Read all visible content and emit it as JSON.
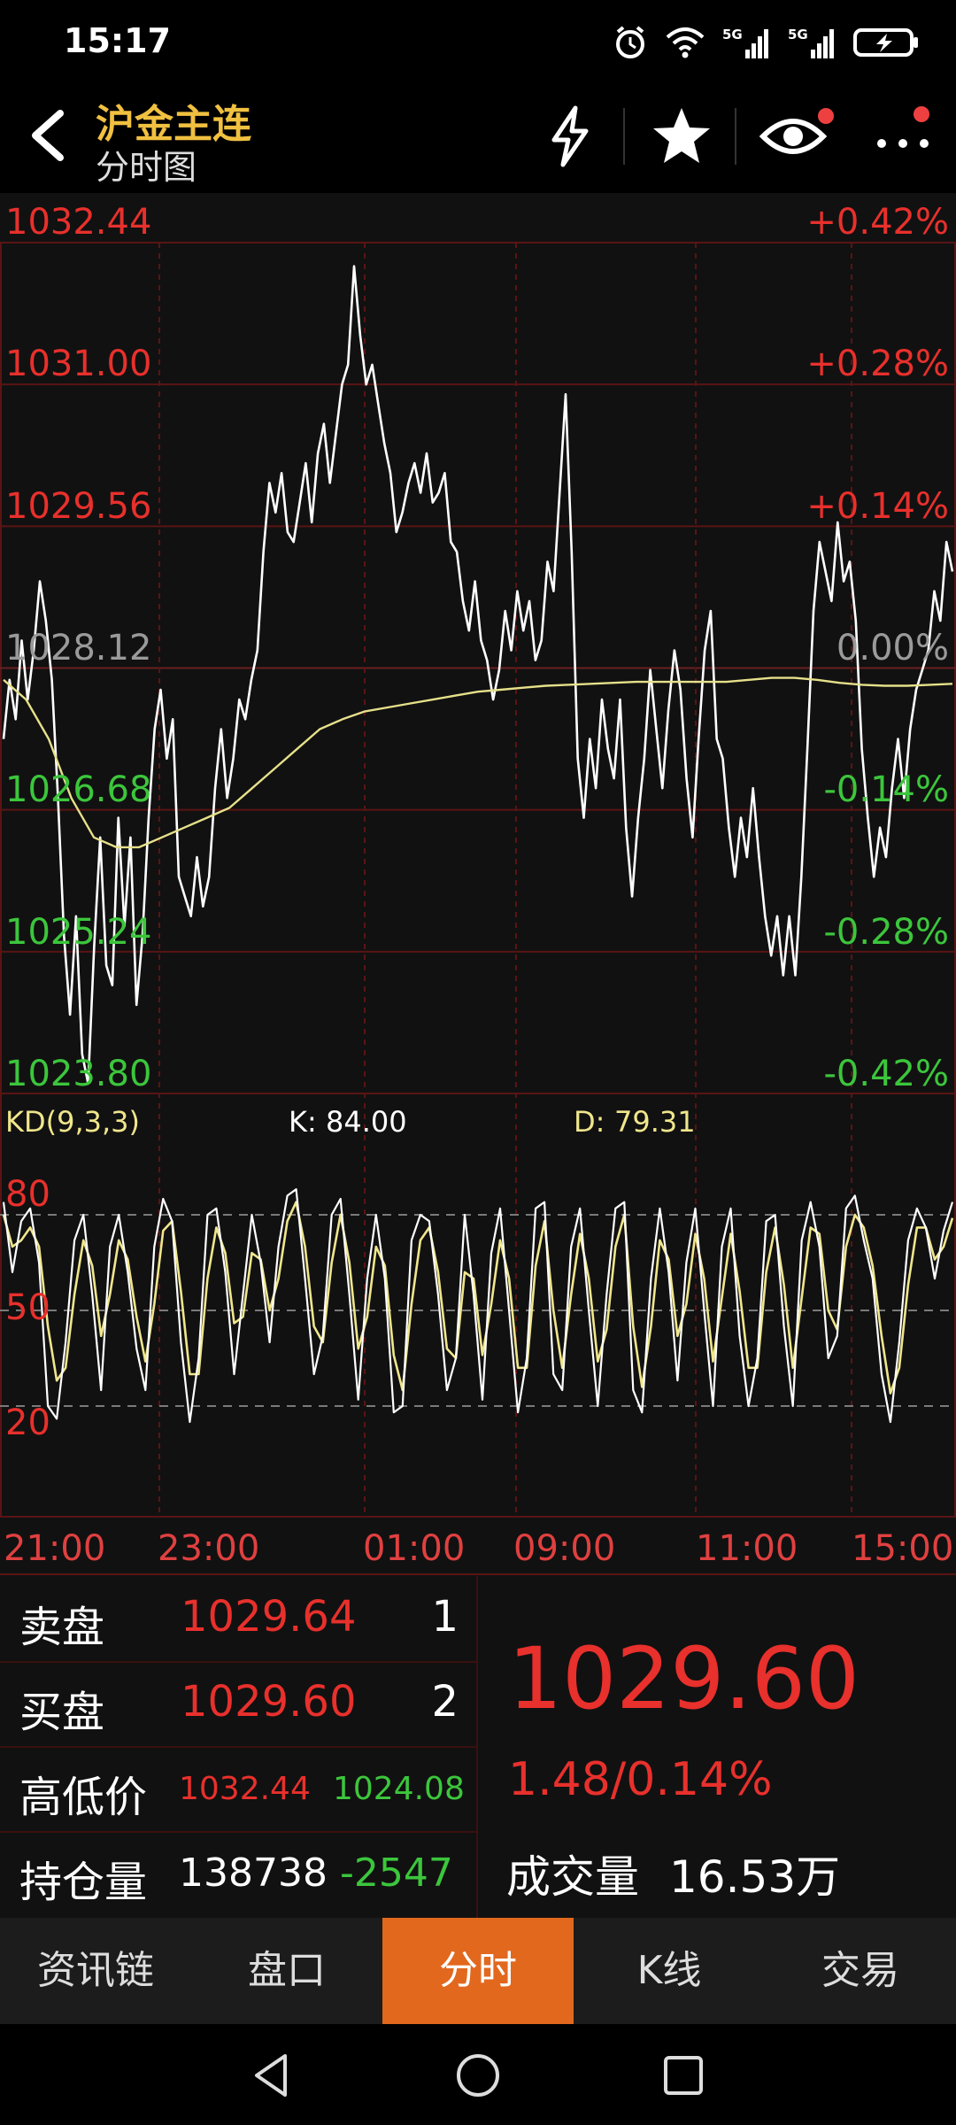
{
  "status_bar": {
    "time": "15:17",
    "icons": [
      "alarm-icon",
      "wifi-icon",
      "5g-signal-icon",
      "5g-signal-icon",
      "battery-charging-icon"
    ]
  },
  "header": {
    "title": "沪金主连",
    "subtitle": "分时图",
    "buttons": [
      "lightning-icon",
      "star-icon",
      "eye-icon",
      "more-icon"
    ]
  },
  "chart_data": [
    {
      "type": "line",
      "title": "",
      "xlabel": "",
      "ylabel": "",
      "x_ticks": [
        "21:00",
        "23:00",
        "01:00",
        "09:00",
        "11:00",
        "15:00"
      ],
      "y_ticks_left": [
        "1032.44",
        "1031.00",
        "1029.56",
        "1028.12",
        "1026.68",
        "1025.24",
        "1023.80"
      ],
      "y_ticks_right": [
        "+0.42%",
        "+0.28%",
        "+0.14%",
        "0.00%",
        "-0.14%",
        "-0.28%",
        "-0.42%"
      ],
      "ylim": [
        1023.8,
        1032.44
      ],
      "reference_price": 1028.12,
      "colors": {
        "up": "#e8302c",
        "flat": "#9a9a9a",
        "down": "#3cc63c",
        "price_line": "#ffffff",
        "avg_line": "#e6e08a",
        "grid": "#5a1414"
      },
      "series": [
        {
          "values": [
            1027.4,
            1028.0,
            1027.6,
            1028.4,
            1027.8,
            1028.3,
            1029.0,
            1028.6,
            1028.0,
            1026.8,
            1025.4,
            1024.6,
            1025.6,
            1024.2,
            1023.9,
            1025.3,
            1026.4,
            1025.1,
            1024.9,
            1026.6,
            1025.5,
            1026.4,
            1024.7,
            1025.4,
            1026.6,
            1027.5,
            1027.9,
            1027.2,
            1027.6,
            1026.0,
            1025.8,
            1025.6,
            1026.2,
            1025.7,
            1026.0,
            1026.9,
            1027.5,
            1026.8,
            1027.2,
            1027.8,
            1027.6,
            1028.0,
            1028.3,
            1029.3,
            1030.0,
            1029.7,
            1030.1,
            1029.5,
            1029.4,
            1029.8,
            1030.2,
            1029.6,
            1030.3,
            1030.6,
            1030.0,
            1030.5,
            1031.0,
            1031.2,
            1032.2,
            1031.5,
            1031.0,
            1031.2,
            1030.8,
            1030.4,
            1030.1,
            1029.5,
            1029.7,
            1030.0,
            1030.2,
            1029.9,
            1030.3,
            1029.8,
            1029.9,
            1030.1,
            1029.4,
            1029.3,
            1028.8,
            1028.5,
            1029.0,
            1028.4,
            1028.2,
            1027.8,
            1028.1,
            1028.7,
            1028.3,
            1028.9,
            1028.5,
            1028.8,
            1028.2,
            1028.4,
            1029.2,
            1028.9,
            1029.9,
            1030.9,
            1029.3,
            1027.2,
            1026.6,
            1027.4,
            1026.9,
            1027.8,
            1027.3,
            1027.0,
            1027.8,
            1026.5,
            1025.8,
            1026.6,
            1027.2,
            1028.1,
            1027.5,
            1026.9,
            1027.7,
            1028.3,
            1027.9,
            1027.0,
            1026.4,
            1027.4,
            1028.3,
            1028.7,
            1027.4,
            1027.2,
            1026.5,
            1026.0,
            1026.6,
            1026.2,
            1026.9,
            1026.2,
            1025.6,
            1025.2,
            1025.6,
            1025.0,
            1025.6,
            1025.0,
            1026.0,
            1027.3,
            1028.7,
            1029.4,
            1029.1,
            1028.8,
            1029.6,
            1029.0,
            1029.2,
            1028.6,
            1027.3,
            1026.6,
            1026.0,
            1026.5,
            1026.2,
            1026.9,
            1027.4,
            1026.8,
            1027.5,
            1027.9,
            1028.1,
            1028.3,
            1028.9,
            1028.6,
            1029.4,
            1029.1
          ]
        },
        {
          "values": [
            1028.0,
            1027.8,
            1027.4,
            1026.8,
            1026.4,
            1026.3,
            1026.3,
            1026.4,
            1026.5,
            1026.6,
            1026.7,
            1026.9,
            1027.1,
            1027.3,
            1027.5,
            1027.6,
            1027.68,
            1027.72,
            1027.76,
            1027.8,
            1027.84,
            1027.88,
            1027.9,
            1027.92,
            1027.94,
            1027.95,
            1027.96,
            1027.97,
            1027.98,
            1027.98,
            1027.98,
            1027.98,
            1027.98,
            1028.0,
            1028.02,
            1028.02,
            1028.0,
            1027.97,
            1027.95,
            1027.94,
            1027.94,
            1027.95,
            1027.96
          ]
        }
      ]
    },
    {
      "type": "line",
      "title": "KD(9,3,3)",
      "x_ticks": [
        "21:00",
        "23:00",
        "01:00",
        "09:00",
        "11:00",
        "15:00"
      ],
      "y_ticks": [
        "80",
        "50",
        "20"
      ],
      "ylim": [
        0,
        100
      ],
      "readouts": [
        {
          "label": "K:",
          "value": "84.00"
        },
        {
          "label": "D:",
          "value": "79.31"
        }
      ],
      "colors": {
        "k": "#ffffff",
        "d": "#f0e68c",
        "label_k": "#ffffff",
        "label_d": "#f0e68c"
      },
      "series": [
        {
          "name": "K",
          "values": [
            84,
            62,
            78,
            82,
            65,
            20,
            16,
            40,
            72,
            80,
            55,
            25,
            70,
            80,
            62,
            38,
            25,
            70,
            85,
            78,
            40,
            15,
            35,
            80,
            82,
            62,
            30,
            55,
            80,
            65,
            40,
            70,
            86,
            88,
            60,
            30,
            42,
            80,
            85,
            55,
            22,
            60,
            80,
            60,
            18,
            20,
            72,
            80,
            78,
            55,
            25,
            35,
            80,
            55,
            22,
            68,
            82,
            50,
            18,
            35,
            82,
            84,
            30,
            25,
            70,
            82,
            50,
            20,
            55,
            82,
            84,
            25,
            18,
            60,
            82,
            62,
            28,
            65,
            82,
            50,
            20,
            70,
            82,
            42,
            20,
            35,
            78,
            80,
            45,
            20,
            72,
            84,
            70,
            35,
            42,
            82,
            86,
            72,
            60,
            30,
            15,
            40,
            72,
            82,
            76,
            60,
            75,
            84
          ]
        },
        {
          "name": "D",
          "values": [
            80,
            70,
            72,
            76,
            70,
            45,
            28,
            32,
            55,
            72,
            64,
            42,
            55,
            72,
            66,
            48,
            34,
            52,
            75,
            78,
            56,
            30,
            30,
            60,
            76,
            68,
            46,
            48,
            68,
            66,
            50,
            60,
            78,
            84,
            70,
            45,
            40,
            65,
            80,
            65,
            38,
            48,
            70,
            64,
            36,
            25,
            52,
            72,
            76,
            62,
            38,
            35,
            62,
            60,
            36,
            52,
            72,
            60,
            32,
            32,
            64,
            78,
            50,
            32,
            55,
            74,
            60,
            34,
            44,
            70,
            80,
            45,
            26,
            45,
            72,
            66,
            42,
            52,
            74,
            60,
            34,
            54,
            74,
            56,
            32,
            32,
            62,
            76,
            58,
            32,
            54,
            76,
            74,
            50,
            44,
            70,
            80,
            76,
            64,
            42,
            24,
            32,
            58,
            76,
            76,
            66,
            70,
            79
          ]
        }
      ]
    }
  ],
  "quote": {
    "sell_label": "卖盘",
    "sell_price": "1029.64",
    "sell_qty": "1",
    "buy_label": "买盘",
    "buy_price": "1029.60",
    "buy_qty": "2",
    "hl_label": "高低价",
    "high": "1032.44",
    "low": "1024.08",
    "oi_label": "持仓量",
    "oi": "138738",
    "oi_change": "-2547",
    "last_price": "1029.60",
    "change": "1.48/0.14%",
    "volume_label": "成交量",
    "volume": "16.53万"
  },
  "tabs": [
    {
      "label": "资讯链",
      "active": false
    },
    {
      "label": "盘口",
      "active": false
    },
    {
      "label": "分时",
      "active": true
    },
    {
      "label": "K线",
      "active": false
    },
    {
      "label": "交易",
      "active": false
    }
  ],
  "navbar": [
    "back-triangle-icon",
    "home-circle-icon",
    "recents-square-icon"
  ]
}
